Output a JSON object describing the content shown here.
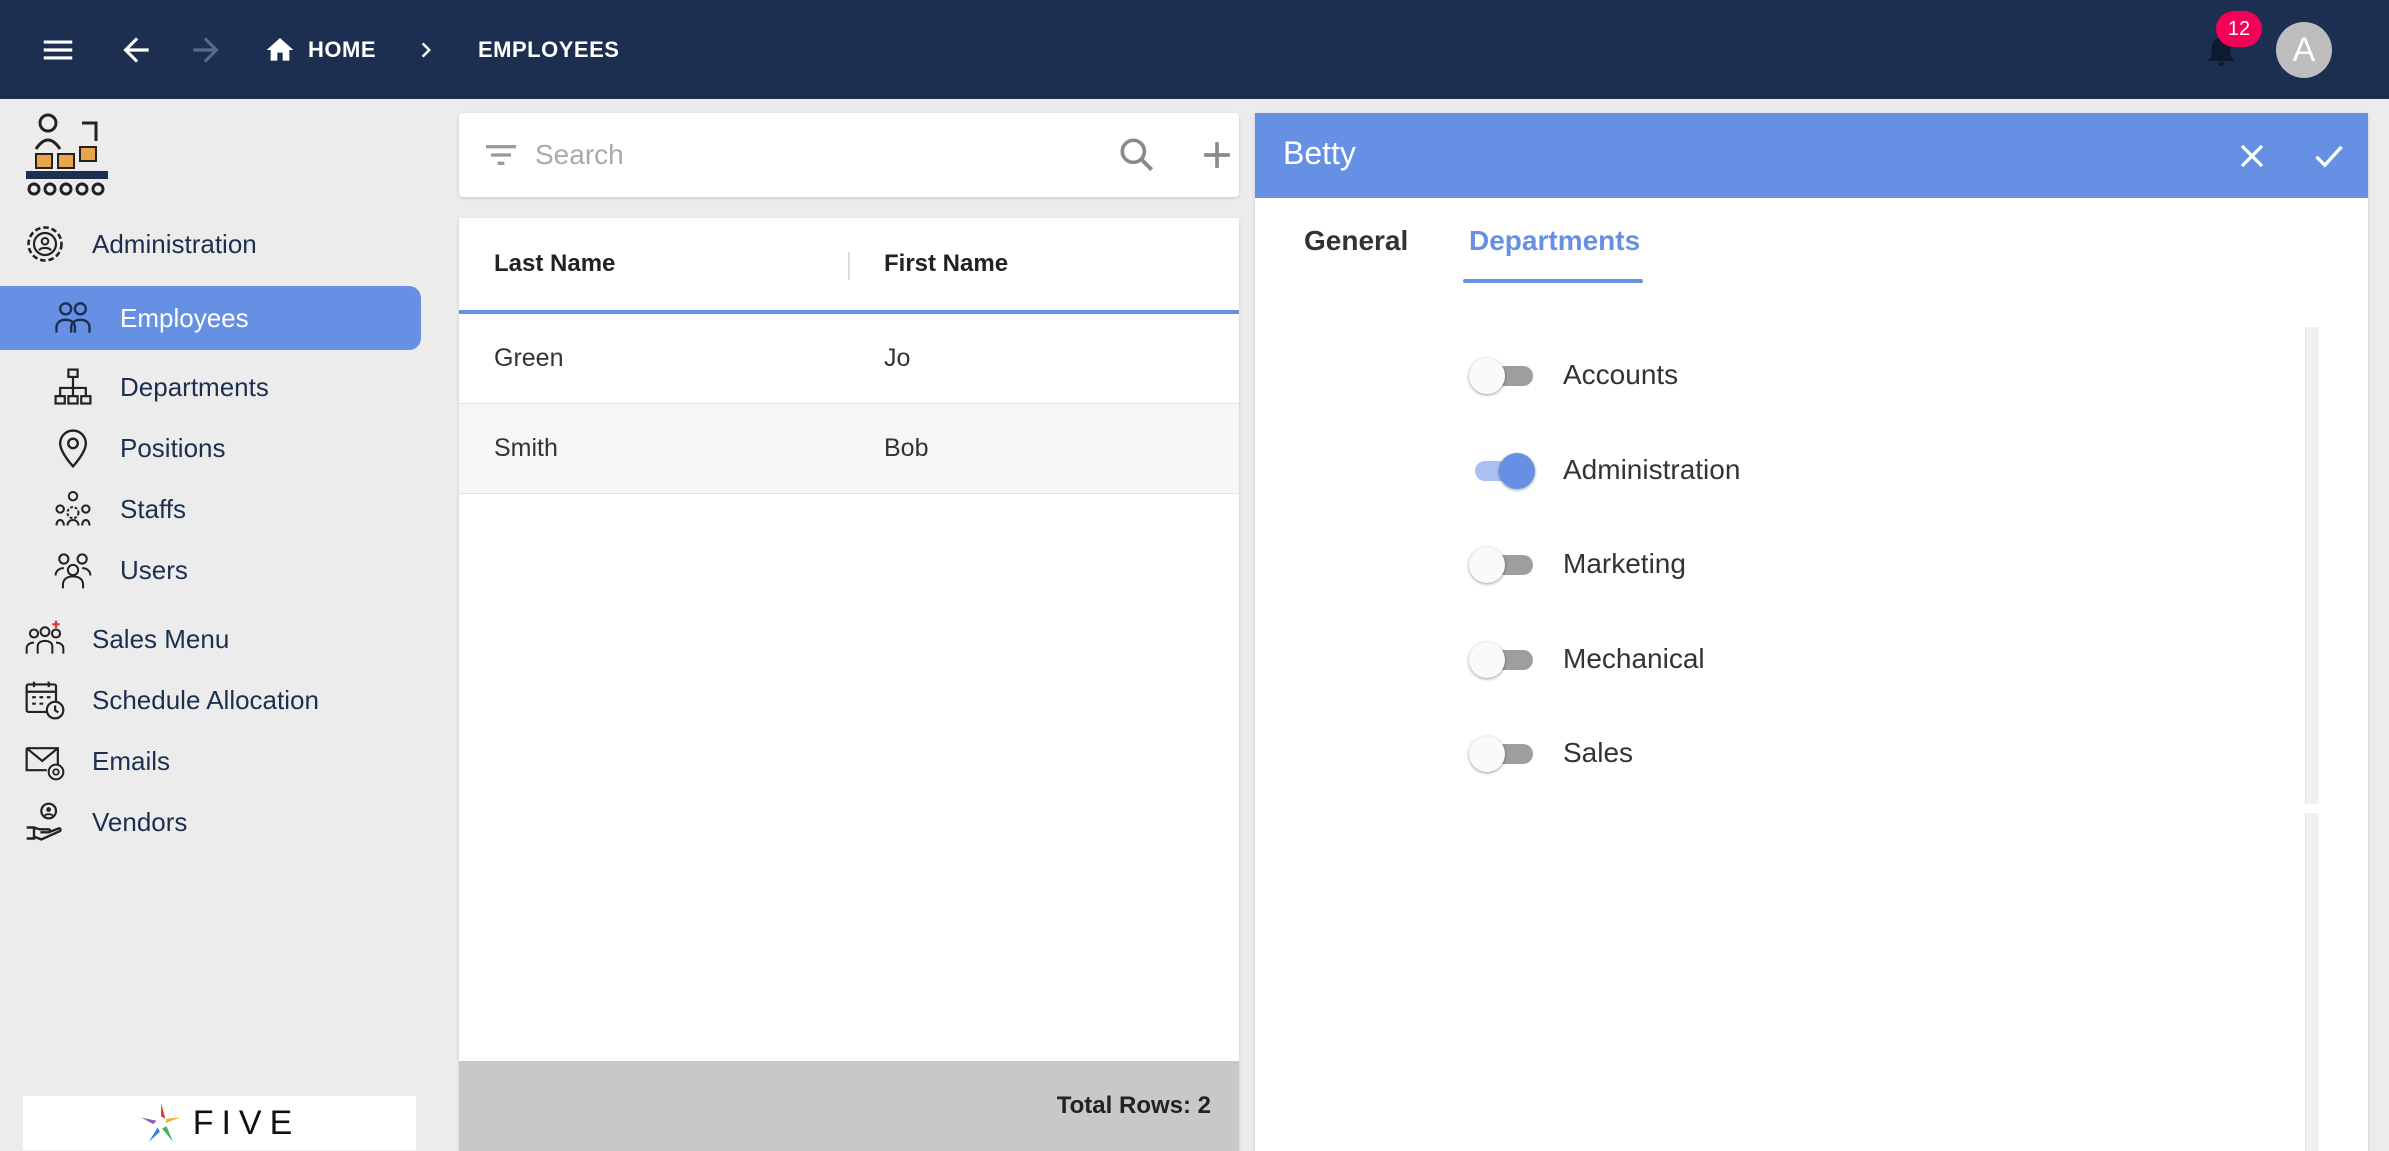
{
  "header": {
    "breadcrumb_home": "HOME",
    "breadcrumb_current": "EMPLOYEES",
    "notifications_count": "12",
    "avatar_letter": "A"
  },
  "sidebar": {
    "items": [
      {
        "label": "Administration",
        "icon": "gear-user-icon"
      },
      {
        "label": "Employees",
        "icon": "employees-icon",
        "active": true
      },
      {
        "label": "Departments",
        "icon": "org-chart-icon"
      },
      {
        "label": "Positions",
        "icon": "location-pin-icon"
      },
      {
        "label": "Staffs",
        "icon": "staff-icon"
      },
      {
        "label": "Users",
        "icon": "users-icon"
      },
      {
        "label": "Sales Menu",
        "icon": "sales-team-icon"
      },
      {
        "label": "Schedule Allocation",
        "icon": "calendar-clock-icon"
      },
      {
        "label": "Emails",
        "icon": "email-icon"
      },
      {
        "label": "Vendors",
        "icon": "vendor-hand-icon"
      }
    ],
    "brand": "FIVE"
  },
  "search": {
    "placeholder": "Search",
    "value": ""
  },
  "table": {
    "columns": [
      "Last Name",
      "First Name"
    ],
    "rows": [
      [
        "Green",
        "Jo"
      ],
      [
        "Smith",
        "Bob"
      ]
    ],
    "footer": "Total Rows: 2"
  },
  "detail": {
    "title": "Betty",
    "tabs": [
      "General",
      "Departments"
    ],
    "active_tab": "Departments",
    "departments": [
      {
        "label": "Accounts",
        "on": false
      },
      {
        "label": "Administration",
        "on": true
      },
      {
        "label": "Marketing",
        "on": false
      },
      {
        "label": "Mechanical",
        "on": false
      },
      {
        "label": "Sales",
        "on": false
      }
    ]
  },
  "colors": {
    "topbar": "#1c2f50",
    "accent": "#6690e4",
    "badge": "#f50057"
  }
}
